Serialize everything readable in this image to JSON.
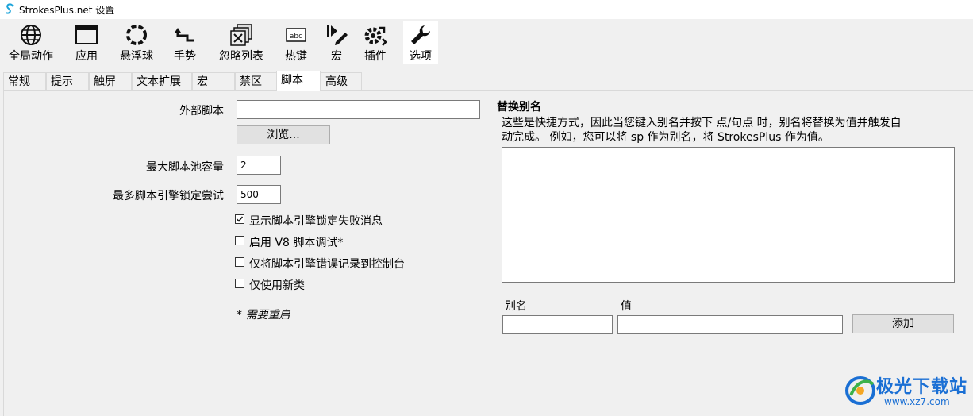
{
  "window": {
    "title": "StrokesPlus.net 设置"
  },
  "toolbar": {
    "items": [
      {
        "label": "全局动作",
        "icon": "globe-icon"
      },
      {
        "label": "应用",
        "icon": "window-icon"
      },
      {
        "label": "悬浮球",
        "icon": "ring-icon"
      },
      {
        "label": "手势",
        "icon": "gesture-arrow-icon"
      },
      {
        "label": "忽略列表",
        "icon": "ignore-list-icon"
      },
      {
        "label": "热键",
        "icon": "keyboard-abc-icon"
      },
      {
        "label": "宏",
        "icon": "macro-icon"
      },
      {
        "label": "插件",
        "icon": "plugin-gear-icon"
      },
      {
        "label": "选项",
        "icon": "wrench-icon"
      }
    ],
    "selected": "选项"
  },
  "tabs": [
    "常规",
    "提示",
    "触屏",
    "文本扩展",
    "宏",
    "禁区",
    "脚本",
    "高级"
  ],
  "active_tab": "脚本",
  "form": {
    "external_script_label": "外部脚本",
    "external_script_value": "",
    "browse_label": "浏览...",
    "max_pool_label": "最大脚本池容量",
    "max_pool_value": "2",
    "max_lock_label": "最多脚本引擎锁定尝试",
    "max_lock_value": "500",
    "checkboxes": [
      {
        "label": "显示脚本引擎锁定失败消息",
        "checked": true
      },
      {
        "label": "启用 V8 脚本调试*",
        "checked": false
      },
      {
        "label": "仅将脚本引擎错误记录到控制台",
        "checked": false
      },
      {
        "label": "仅使用新类",
        "checked": false
      }
    ],
    "restart_note": "* 需要重启"
  },
  "alias": {
    "title": "替换别名",
    "desc_line1": "这些是快捷方式，因此当您键入别名并按下 点/句点 时，别名将替换为值并触发自",
    "desc_line2": "动完成。 例如，您可以将 sp 作为别名，将 StrokesPlus 作为值。",
    "alias_label": "别名",
    "value_label": "值",
    "alias_value": "",
    "value_value": "",
    "add_label": "添加"
  },
  "watermark": {
    "name": "极光下载站",
    "url": "www.xz7.com"
  },
  "colors": {
    "accent": "#1a6fd4",
    "selected_bg": "#ffffff",
    "window_bg": "#f0f0f0"
  }
}
